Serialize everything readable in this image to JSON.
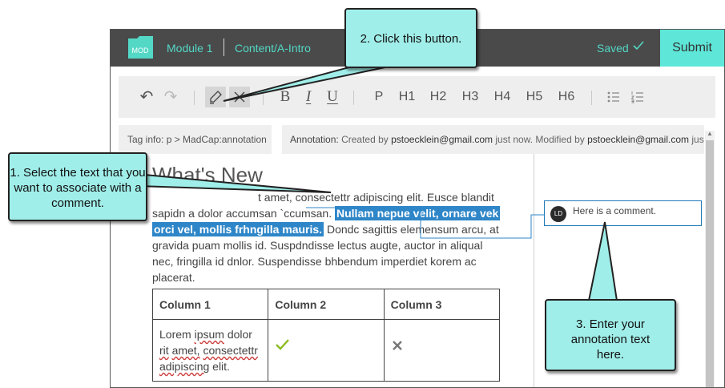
{
  "topbar": {
    "logo_text": "MOD",
    "module": "Module 1",
    "topic": "Content/A-Intro",
    "saved": "Saved",
    "submit_label": "Submit"
  },
  "toolbar": {
    "undo": "↶",
    "redo": "↷",
    "bold": "B",
    "italic": "I",
    "underline": "U",
    "p": "P",
    "h1": "H1",
    "h2": "H2",
    "h3": "H3",
    "h4": "H4",
    "h5": "H5",
    "h6": "H6"
  },
  "info": {
    "tag": "Tag info: p > MadCap:annotation",
    "annotation_label": "Annotation:",
    "created_by": "Created by",
    "created_email": "pstoecklein@gmail.com",
    "created_when": "just now.",
    "modified_by": "Modified by",
    "modified_email": "pstoecklein@gmail.com",
    "modified_when": "just now."
  },
  "content": {
    "title": "What's New",
    "line1_tail": "t amet, consectettr adipiscing elit. Eusce blandit",
    "line2_start": "sapidn a dolor accumsan `ccumsan.",
    "highlight1": "Nullam nepue velit, ornare vek",
    "highlight2": "orci vel, mollis frhngilla mauris.",
    "line3_tail": "Dondc sagittis elemensum arcu, at",
    "line4": "gravida puam mollis id. Suspdndisse lectus augte, auctor in aliqual",
    "line5": "nec, fringilla id dnlor. Suspendisse bhbendum imperdiet korem ac",
    "line6": "placerat."
  },
  "table": {
    "headers": [
      "Column 1",
      "Column 2",
      "Column 3"
    ],
    "cell1_w1": "Lorem",
    "cell1_w2": "ipsum",
    "cell1_w3": "dolor",
    "cell1_w4": "rit",
    "cell1_w5": "amet,",
    "cell1_w6": "consectettr",
    "cell1_w7": "adipiscing",
    "cell1_w8": "elit."
  },
  "comment": {
    "avatar": "LD",
    "text": "Here is a comment."
  },
  "callouts": {
    "c1": "1. Select the text that you want to associate with a comment.",
    "c2": "2. Click this button.",
    "c3": "3. Enter your annotation text here."
  },
  "colors": {
    "topbar": "#4a4a4a",
    "accent": "#53d8c6",
    "submit": "#5ee7d9",
    "highlight": "#2e86c8",
    "callout": "#a0eee9",
    "check": "#8dbb22"
  }
}
